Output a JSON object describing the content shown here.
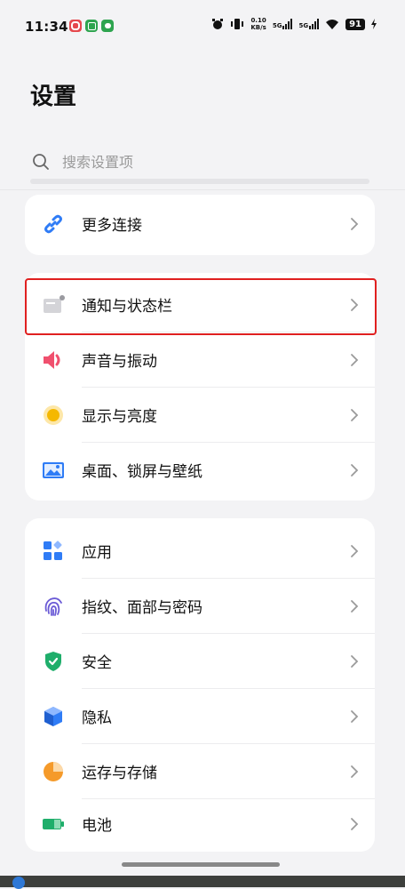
{
  "status_bar": {
    "time": "11:34",
    "net_speed_top": "0.10",
    "net_speed_bottom": "KB/s",
    "signal1_label": "5G",
    "signal2_label": "5G",
    "battery": "91"
  },
  "page_title": "设置",
  "search": {
    "placeholder": "搜索设置项"
  },
  "groups": [
    {
      "items": [
        {
          "label": "更多连接",
          "icon": "link-icon"
        }
      ]
    },
    {
      "items": [
        {
          "label": "通知与状态栏",
          "icon": "notification-icon"
        },
        {
          "label": "声音与振动",
          "icon": "speaker-icon"
        },
        {
          "label": "显示与亮度",
          "icon": "brightness-icon"
        },
        {
          "label": "桌面、锁屏与壁纸",
          "icon": "wallpaper-icon"
        }
      ]
    },
    {
      "items": [
        {
          "label": "应用",
          "icon": "apps-icon"
        },
        {
          "label": "指纹、面部与密码",
          "icon": "fingerprint-icon"
        },
        {
          "label": "安全",
          "icon": "shield-icon"
        },
        {
          "label": "隐私",
          "icon": "privacy-icon"
        },
        {
          "label": "运存与存储",
          "icon": "storage-icon"
        },
        {
          "label": "电池",
          "icon": "battery-icon"
        }
      ]
    }
  ],
  "colors": {
    "highlight": "#e02020",
    "accent_blue": "#2f7cf6"
  }
}
